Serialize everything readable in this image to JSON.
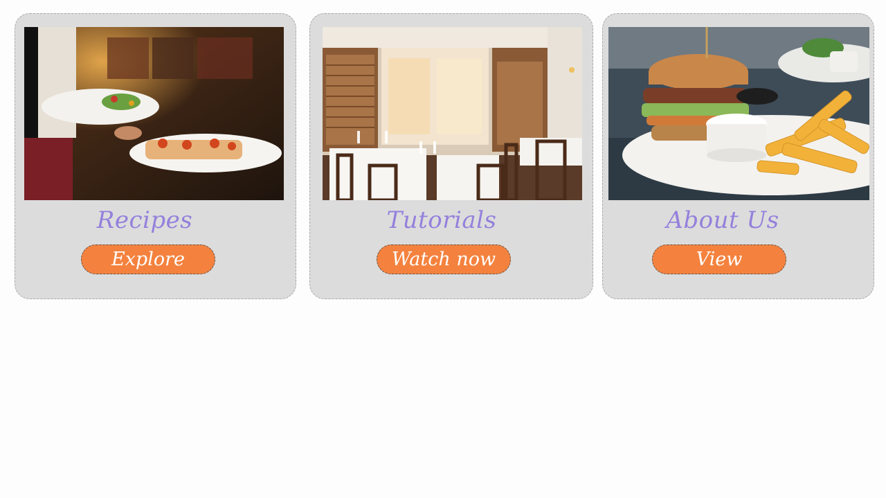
{
  "theme": {
    "title_color": "#9480dc",
    "button_color": "#f4823e",
    "card_color": "#dcdcdc"
  },
  "cards": [
    {
      "title": "Recipes",
      "button_label": "Explore",
      "image": "waiter-serving-plates-photo"
    },
    {
      "title": "Tutorials",
      "button_label": "Watch now",
      "image": "restaurant-dining-room-photo"
    },
    {
      "title": "About Us",
      "button_label": "View",
      "image": "burger-and-fries-photo"
    }
  ]
}
